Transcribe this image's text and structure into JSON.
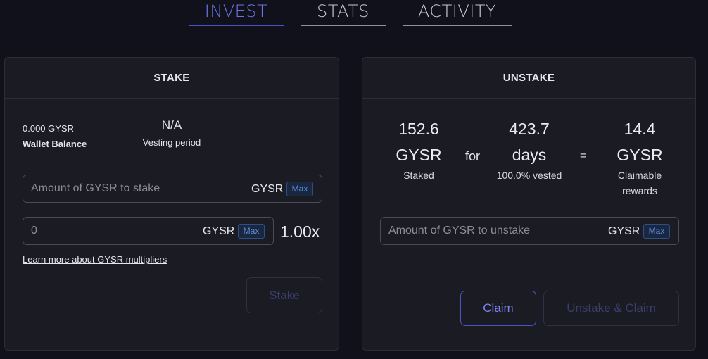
{
  "tabs": [
    {
      "label": "INVEST",
      "active": true
    },
    {
      "label": "STATS",
      "active": false
    },
    {
      "label": "ACTIVITY",
      "active": false
    }
  ],
  "stake": {
    "title": "STAKE",
    "wallet_amount": "0.000 GYSR",
    "wallet_label": "Wallet Balance",
    "vesting_value": "N/A",
    "vesting_label": "Vesting period",
    "amount_placeholder": "Amount of GYSR to stake",
    "amount_unit": "GYSR",
    "amount_max": "Max",
    "multiplier_placeholder": "0",
    "multiplier_unit": "GYSR",
    "multiplier_max": "Max",
    "multiplier_value": "1.00x",
    "learn_more": "Learn more about GYSR multipliers",
    "stake_button": "Stake"
  },
  "unstake": {
    "title": "UNSTAKE",
    "staked_amount": "152.6",
    "staked_unit": "GYSR",
    "staked_label": "Staked",
    "for_text": "for",
    "days_amount": "423.7",
    "days_unit": "days",
    "vested_label": "100.0% vested",
    "equals": "=",
    "rewards_amount": "14.4",
    "rewards_unit": "GYSR",
    "rewards_label_1": "Claimable",
    "rewards_label_2": "rewards",
    "amount_placeholder": "Amount of GYSR to unstake",
    "amount_unit": "GYSR",
    "amount_max": "Max",
    "claim_button": "Claim",
    "unstake_claim_button": "Unstake & Claim"
  },
  "colors": {
    "background": "#10111a",
    "card": "#1b1b23",
    "accent": "#6b73e3",
    "max_badge": "#5d8bdc"
  }
}
